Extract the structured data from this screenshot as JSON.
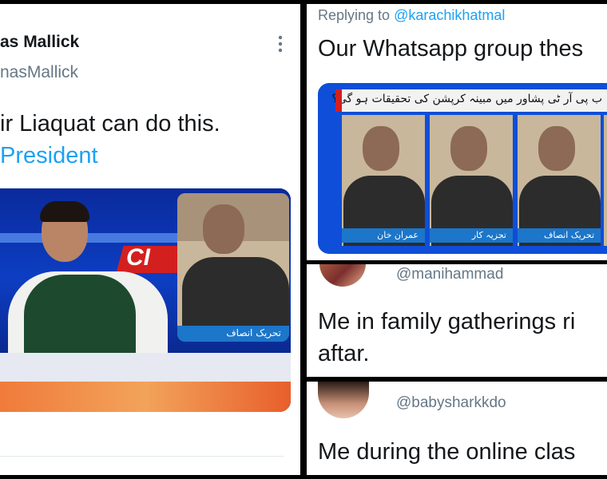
{
  "left_tweet": {
    "display_name": "as Mallick",
    "handle": "nasMallick",
    "more_icon": "more-vertical-icon",
    "text_line1": "ir Liaquat can do this.",
    "hashtag": "President",
    "media": {
      "channel_badge": "CI",
      "caption": "تحریک انصاف"
    }
  },
  "right_top": {
    "replying_prefix": "Replying to",
    "replying_handle": "@karachikhatmal",
    "text": "Our Whatsapp group thes",
    "media": {
      "headline": "ب پی آر ٹی پشاور میں مبینہ کرپشن کی تحقیقات ہو گی؟",
      "captions": [
        "عمران خان",
        "تجزیہ کار",
        "تحریک انصاف"
      ]
    }
  },
  "right_mid": {
    "handle": "@manihammad",
    "text_line1": "Me in family gatherings ri",
    "text_line2": "aftar."
  },
  "right_bottom": {
    "handle": "@babysharkkdo",
    "text": "Me during the online clas"
  },
  "colors": {
    "link": "#1da1f2",
    "muted": "#657786",
    "divider": "#000000"
  }
}
